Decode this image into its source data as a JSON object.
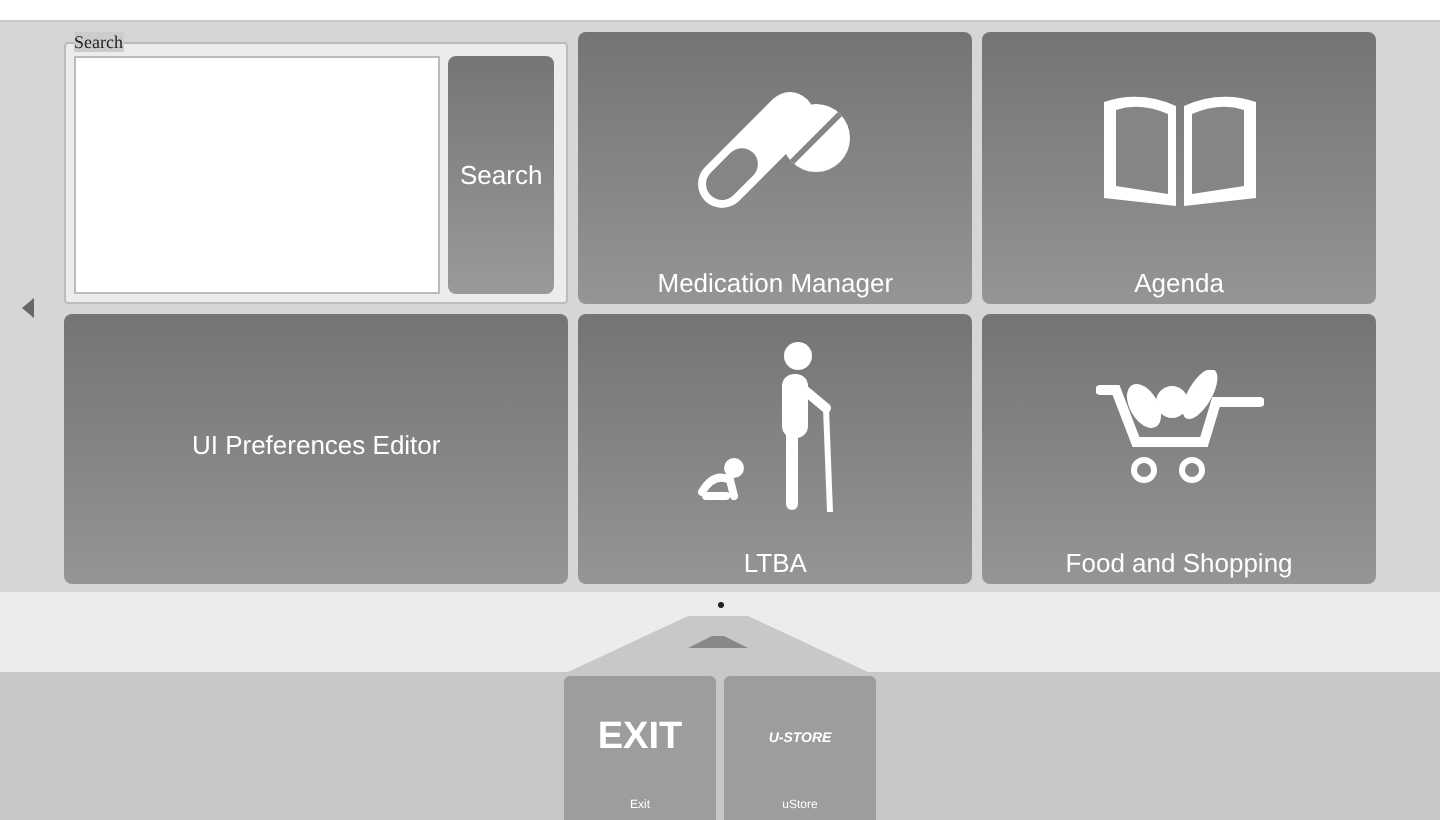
{
  "search": {
    "legend": "Search",
    "button": "Search"
  },
  "tiles": [
    {
      "kind": "pills",
      "label": "Medication Manager"
    },
    {
      "kind": "book",
      "label": "Agenda"
    },
    {
      "kind": "text",
      "label": "UI Preferences Editor"
    },
    {
      "kind": "people",
      "label": "LTBA"
    },
    {
      "kind": "cart",
      "label": "Food and Shopping"
    }
  ],
  "dock": [
    {
      "kind": "exit",
      "logo": "EXIT",
      "label": "Exit"
    },
    {
      "kind": "store",
      "logo": "U-STORE",
      "label": "uStore"
    }
  ]
}
